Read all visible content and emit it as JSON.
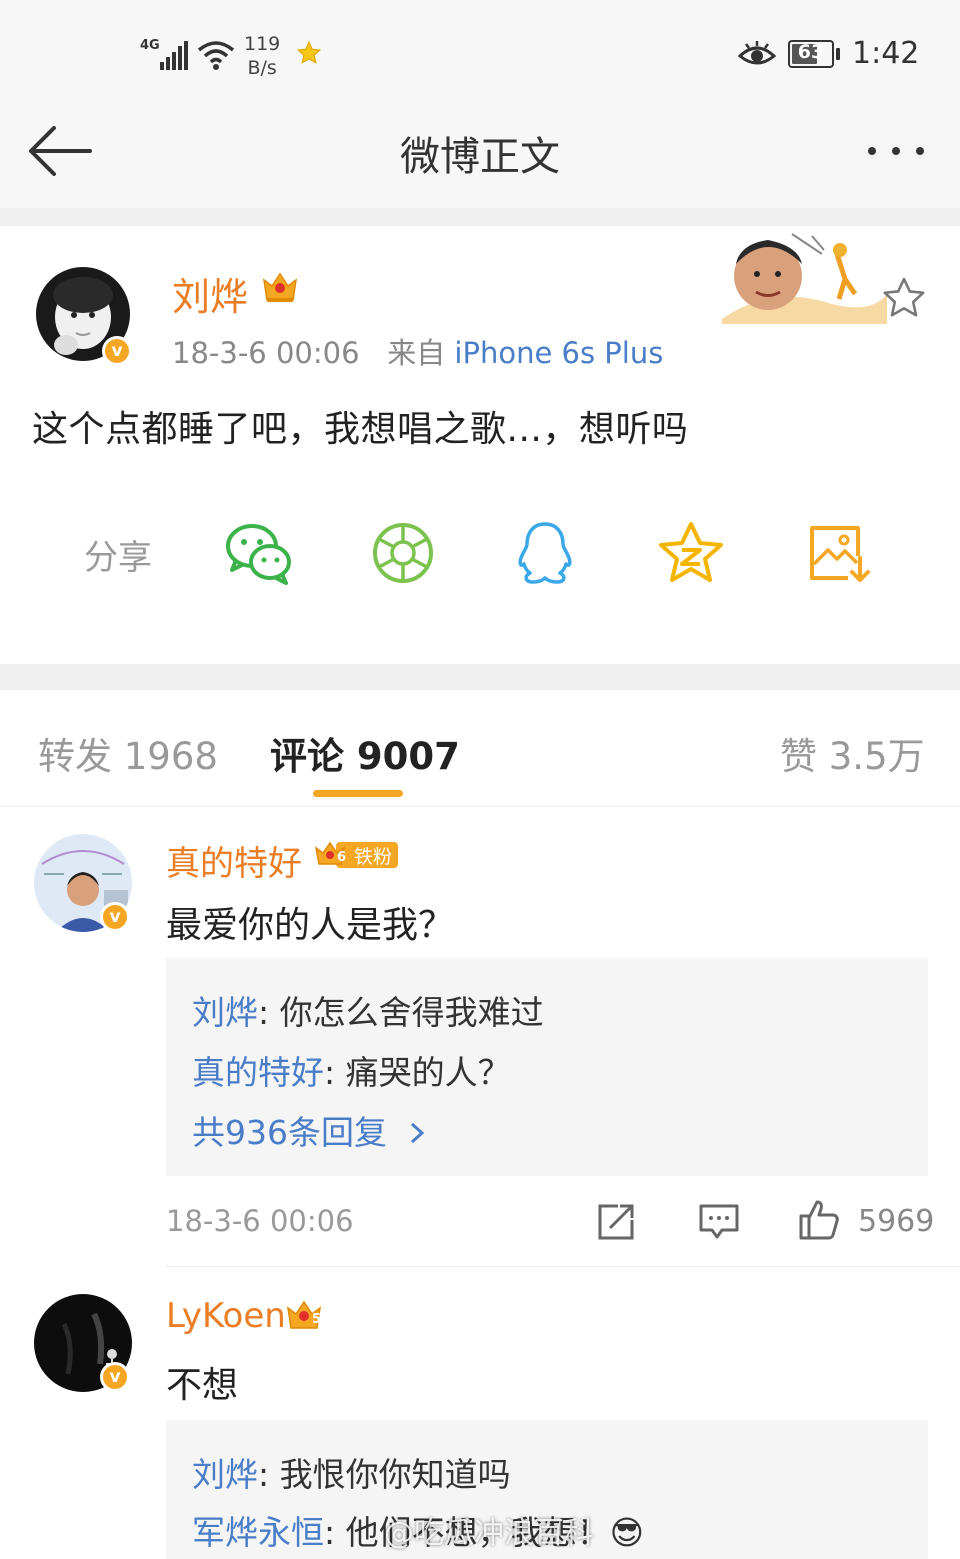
{
  "status_bar": {
    "network": "4G",
    "speed_value": "119",
    "speed_unit": "B/s",
    "battery": "63",
    "time": "1:42"
  },
  "nav": {
    "title": "微博正文",
    "back_icon": "arrow-left-icon",
    "more_icon": "ellipsis-icon"
  },
  "post": {
    "user": "刘烨",
    "date": "18-3-6 00:06",
    "source_prefix": "来自",
    "source": "iPhone 6s Plus",
    "text": "这个点都睡了吧，我想唱之歌...，想听吗"
  },
  "share": {
    "label": "分享",
    "icons": [
      "wechat-icon",
      "moments-icon",
      "qq-icon",
      "qzone-icon",
      "save-image-icon"
    ]
  },
  "tabs": {
    "repost": "转发 1968",
    "comment": "评论 9007",
    "like": "赞 3.5万"
  },
  "comments": [
    {
      "user": "真的特好",
      "fan_level": "6",
      "fan_badge": "铁粉",
      "text": "最爱你的人是我？",
      "replies": [
        {
          "user": "刘烨",
          "text": "你怎么舍得我难过"
        },
        {
          "user": "真的特好",
          "text": "痛哭的人？"
        }
      ],
      "more_replies": "共936条回复",
      "time": "18-3-6 00:06",
      "likes": "5969"
    },
    {
      "user": "LyKoen",
      "fan_level": "5",
      "text": "不想",
      "replies": [
        {
          "user": "刘烨",
          "text": "我恨你你知道吗"
        },
        {
          "user": "军烨永恒",
          "text": "他们不想，我想！😎"
        }
      ]
    }
  ],
  "watermark": "@吃瓜冲浪百科",
  "colors": {
    "username": "#eb7d25",
    "link": "#4a7dc8",
    "accent": "#f5a623",
    "background_gap": "#efefef"
  }
}
